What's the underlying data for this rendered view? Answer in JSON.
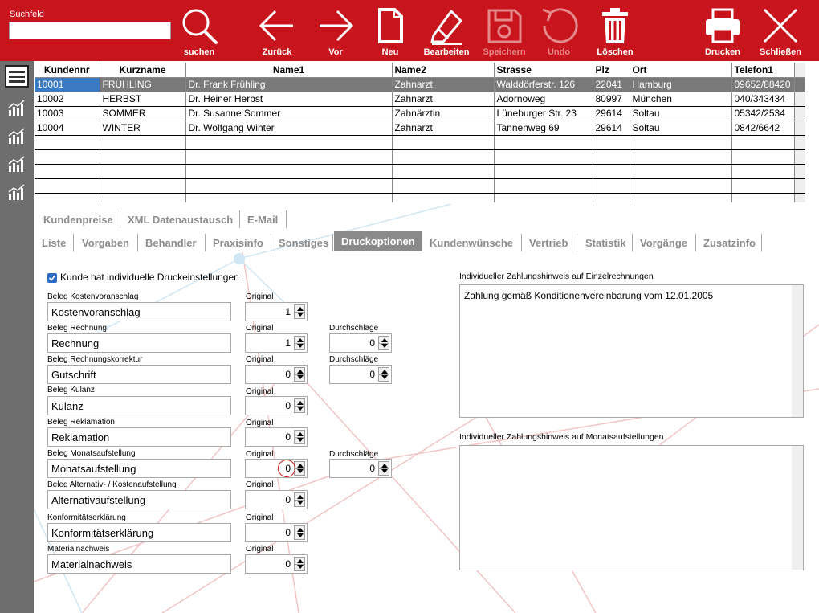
{
  "toolbar": {
    "search_label": "Suchfeld",
    "search_value": "",
    "buttons": {
      "suchen": "suchen",
      "zurueck": "Zurück",
      "vor": "Vor",
      "neu": "Neu",
      "bearbeiten": "Bearbeiten",
      "speichern": "Speichern",
      "undo": "Undo",
      "loeschen": "Löschen",
      "drucken": "Drucken",
      "schliessen": "Schließen"
    }
  },
  "colors": {
    "toolbar_red": "#c8141d",
    "sidebar_gray": "#6e6e6e",
    "selection_blue": "#3a7ac2",
    "selection_gray": "#7a7a7a"
  },
  "grid": {
    "headers": [
      "Kundennr",
      "Kurzname",
      "Name1",
      "Name2",
      "Strasse",
      "Plz",
      "Ort",
      "Telefon1"
    ],
    "rows": [
      [
        "10001",
        "FRÜHLING",
        "Dr. Frank Frühling",
        "Zahnarzt",
        "Walddörferstr. 126",
        "22041",
        "Hamburg",
        "09652/88420"
      ],
      [
        "10002",
        "HERBST",
        "Dr. Heiner Herbst",
        "Zahnarzt",
        "Adornoweg",
        "80997",
        "München",
        "040/343434"
      ],
      [
        "10003",
        "SOMMER",
        "Dr. Susanne Sommer",
        "Zahnärztin",
        "Lüneburger Str. 23",
        "29614",
        "Soltau",
        "05342/2534"
      ],
      [
        "10004",
        "WINTER",
        "Dr. Wolfgang Winter",
        "Zahnarzt",
        "Tannenweg 69",
        "29614",
        "Soltau",
        "0842/6642"
      ]
    ]
  },
  "tabs_row1": [
    "Kundenpreise",
    "XML Datenaustausch",
    "E-Mail"
  ],
  "tabs_row2": [
    "Liste",
    "Vorgaben",
    "Behandler",
    "Praxisinfo",
    "Sonstiges",
    "Druckoptionen",
    "Kundenwünsche",
    "Vertrieb",
    "Statistik",
    "Vorgänge",
    "Zusatzinfo"
  ],
  "active_tab": "Druckoptionen",
  "form": {
    "checkbox_label": "Kunde hat individuelle Druckeinstellungen",
    "checkbox_checked": true,
    "original_label": "Original",
    "durchschlaege_label": "Durchschläge",
    "belege": [
      {
        "label": "Beleg Kostenvoranschlag",
        "value": "Kostenvoranschlag",
        "original": "1"
      },
      {
        "label": "Beleg Rechnung",
        "value": "Rechnung",
        "original": "1",
        "durchschlaege": "0"
      },
      {
        "label": "Beleg Rechnungskorrektur",
        "value": "Gutschrift",
        "original": "0",
        "durchschlaege": "0"
      },
      {
        "label": "Beleg Kulanz",
        "value": "Kulanz",
        "original": "0"
      },
      {
        "label": "Beleg Reklamation",
        "value": "Reklamation",
        "original": "0"
      },
      {
        "label": "Beleg Monatsaufstellung",
        "value": "Monatsaufstellung",
        "original": "0",
        "durchschlaege": "0"
      },
      {
        "label": "Beleg Alternativ- / Kostenaufstellung",
        "value": "Alternativaufstellung",
        "original": "0"
      },
      {
        "label": "Konformitätserklärung",
        "value": "Konformitätserklärung",
        "original": "0"
      },
      {
        "label": "Materialnachweis",
        "value": "Materialnachweis",
        "original": "0"
      }
    ],
    "zahlungshinweis_einzel_label": "Individueller Zahlungshinweis auf Einzelrechnungen",
    "zahlungshinweis_einzel_value": "Zahlung gemäß Konditionenvereinbarung vom 12.01.2005",
    "zahlungshinweis_monat_label": "Individueller Zahlungshinweis auf Monatsaufstellungen",
    "zahlungshinweis_monat_value": ""
  }
}
